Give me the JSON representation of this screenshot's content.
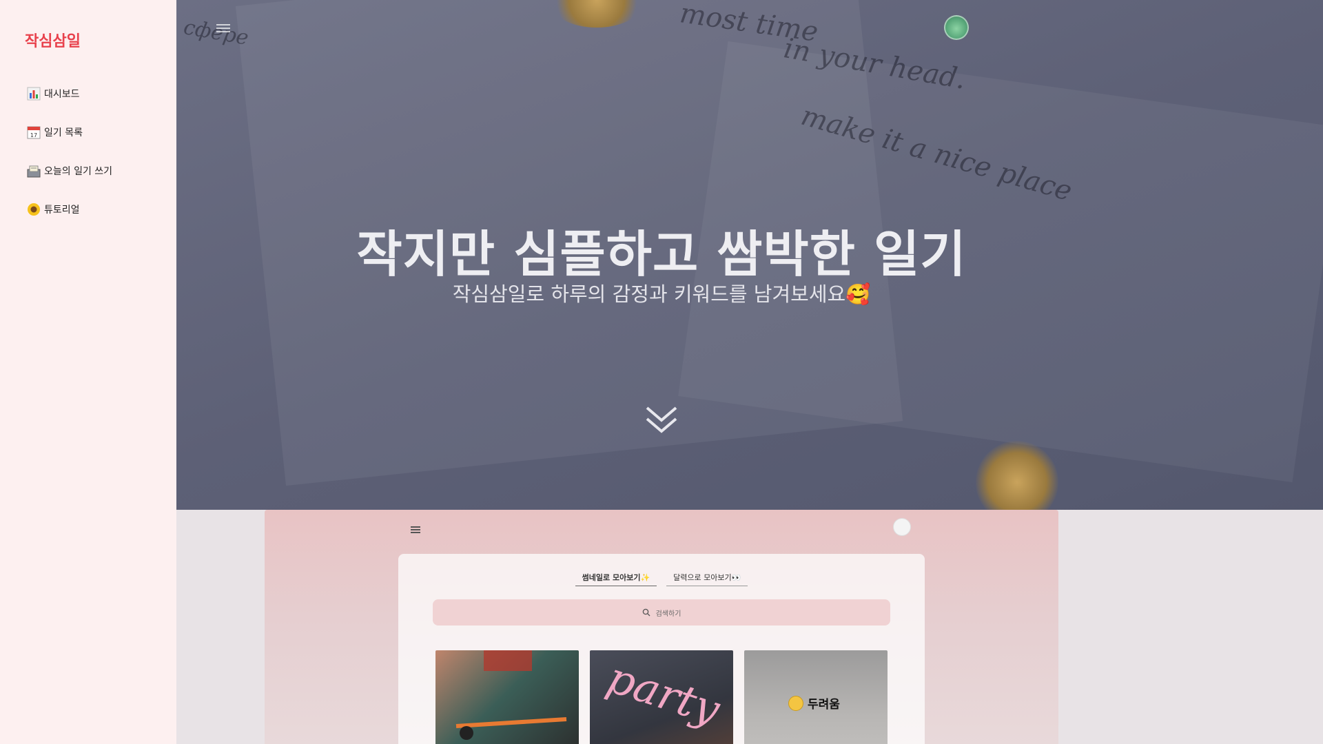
{
  "sidebar": {
    "brand": "작심삼일",
    "items": [
      {
        "label": "대시보드",
        "icon": "bar-chart-icon"
      },
      {
        "label": "일기 목록",
        "icon": "calendar-icon"
      },
      {
        "label": "오늘의 일기 쓰기",
        "icon": "card-box-icon"
      },
      {
        "label": "튜토리얼",
        "icon": "sunflower-icon"
      }
    ]
  },
  "hero": {
    "title": "작지만 심플하고 쌈박한 일기",
    "subtitle": "작심삼일로 하루의 감정과 키워드를 남겨보세요🥰",
    "background_script": [
      "сфере",
      "most time",
      "in your head.",
      "make it a nice place"
    ]
  },
  "preview": {
    "tabs": [
      "썸네일로 모아보기✨",
      "달력으로 모아보기👀"
    ],
    "search_placeholder": "검색하기",
    "cards": [
      {
        "kind": "photo",
        "subject": "bicycle"
      },
      {
        "kind": "photo",
        "text": "party"
      },
      {
        "kind": "mood",
        "label": "두려움"
      }
    ]
  },
  "colors": {
    "brand": "#e8414c",
    "sidebar_bg": "#fdf0f0",
    "search_bg": "#f0d2d3"
  }
}
